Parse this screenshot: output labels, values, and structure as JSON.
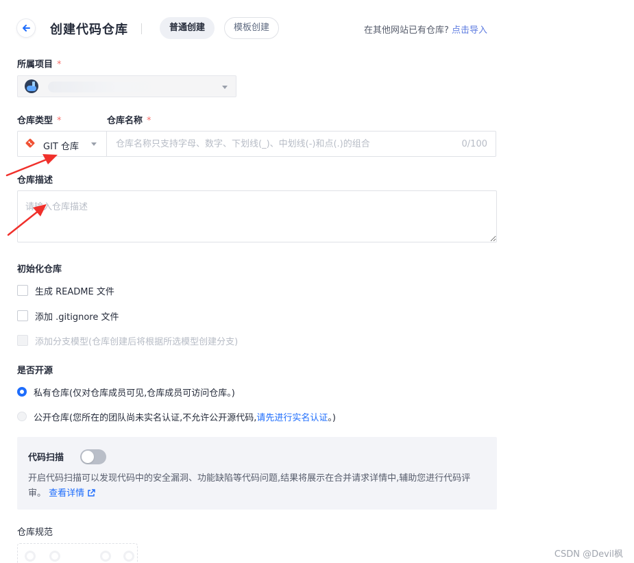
{
  "header": {
    "title": "创建代码仓库",
    "tabs": [
      {
        "label": "普通创建",
        "active": true
      },
      {
        "label": "模板创建",
        "active": false
      }
    ],
    "import_hint": "在其他网站已有仓库?",
    "import_link": "点击导入"
  },
  "project": {
    "label": "所属项目",
    "required_mark": "*"
  },
  "repo_type": {
    "label": "仓库类型",
    "required_mark": "*",
    "value": "GIT 仓库"
  },
  "repo_name": {
    "label": "仓库名称",
    "required_mark": "*",
    "placeholder": "仓库名称只支持字母、数字、下划线(_)、中划线(-)和点(.)的组合",
    "value": "",
    "count": "0/100"
  },
  "description": {
    "label": "仓库描述",
    "placeholder": "请输入仓库描述"
  },
  "init": {
    "label": "初始化仓库",
    "options": [
      {
        "label": "生成 README 文件",
        "checked": false,
        "disabled": false
      },
      {
        "label": "添加 .gitignore 文件",
        "checked": false,
        "disabled": false
      },
      {
        "label": "添加分支模型(仓库创建后将根据所选模型创建分支)",
        "checked": false,
        "disabled": true
      }
    ]
  },
  "open_source": {
    "label": "是否开源",
    "private_label": "私有仓库(仅对仓库成员可见,仓库成员可访问仓库。)",
    "public_label_prefix": "公开仓库(您所在的团队尚未实名认证,不允许公开源代码,",
    "public_link": "请先进行实名认证",
    "public_label_suffix": "。)"
  },
  "code_scan": {
    "title": "代码扫描",
    "enabled": false,
    "description": "开启代码扫描可以发现代码中的安全漏洞、功能缺陷等代码问题,结果将展示在合并请求详情中,辅助您进行代码评审。",
    "link": "查看详情"
  },
  "standards": {
    "label": "仓库规范"
  },
  "watermark": "CSDN @Devil枫",
  "colors": {
    "primary": "#1e6dfc",
    "required": "#f66f6a",
    "annotation_arrow": "#f0302b"
  }
}
